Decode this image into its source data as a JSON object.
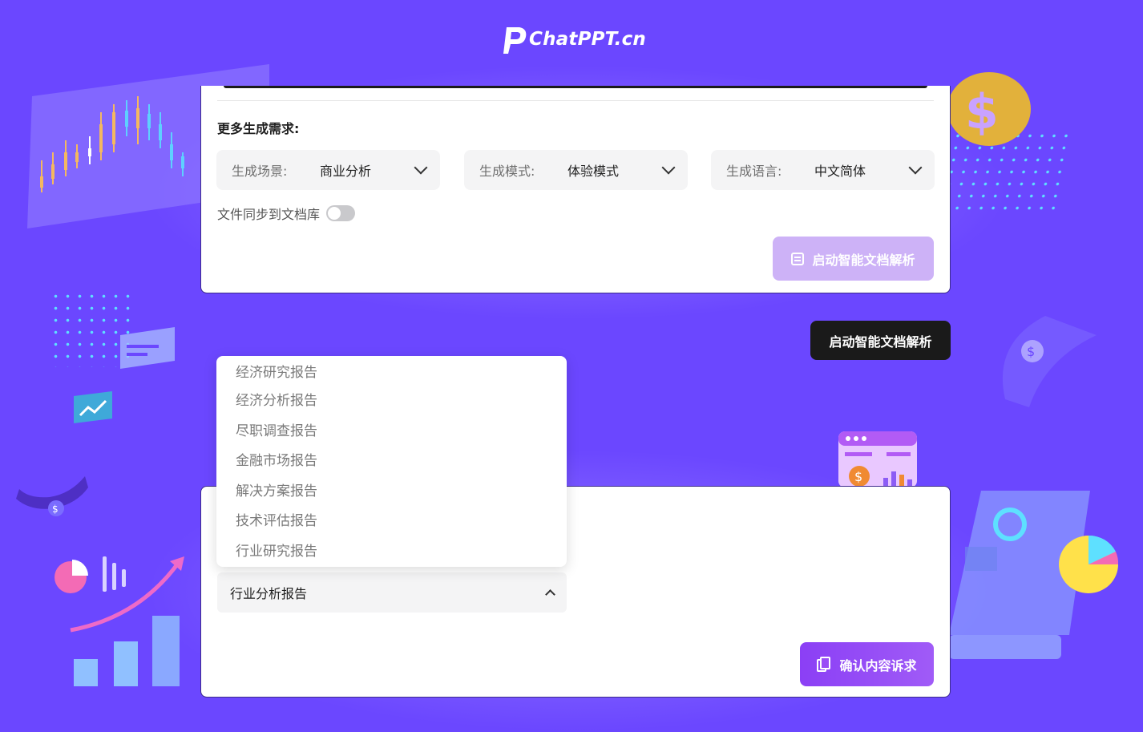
{
  "brand": {
    "logo_text": "ChatPPT.cn"
  },
  "settings_card": {
    "section_title": "更多生成需求:",
    "selects": [
      {
        "label": "生成场景:",
        "value": "商业分析"
      },
      {
        "label": "生成模式:",
        "value": "体验模式"
      },
      {
        "label": "生成语言:",
        "value": "中文简体"
      }
    ],
    "sync_label": "文件同步到文档库",
    "sync_enabled": false,
    "start_button": "启动智能文档解析"
  },
  "tooltip": {
    "text": "启动智能文档解析"
  },
  "report_dropdown": {
    "options": [
      "经济研究报告",
      "经济分析报告",
      "尽职调查报告",
      "金融市场报告",
      "解决方案报告",
      "技术评估报告",
      "行业研究报告"
    ],
    "selected": "行业分析报告"
  },
  "confirm_button": "确认内容诉求",
  "colors": {
    "background": "#6b47ff",
    "accent": "#9a4df6",
    "disabled": "#cdb2f7"
  }
}
